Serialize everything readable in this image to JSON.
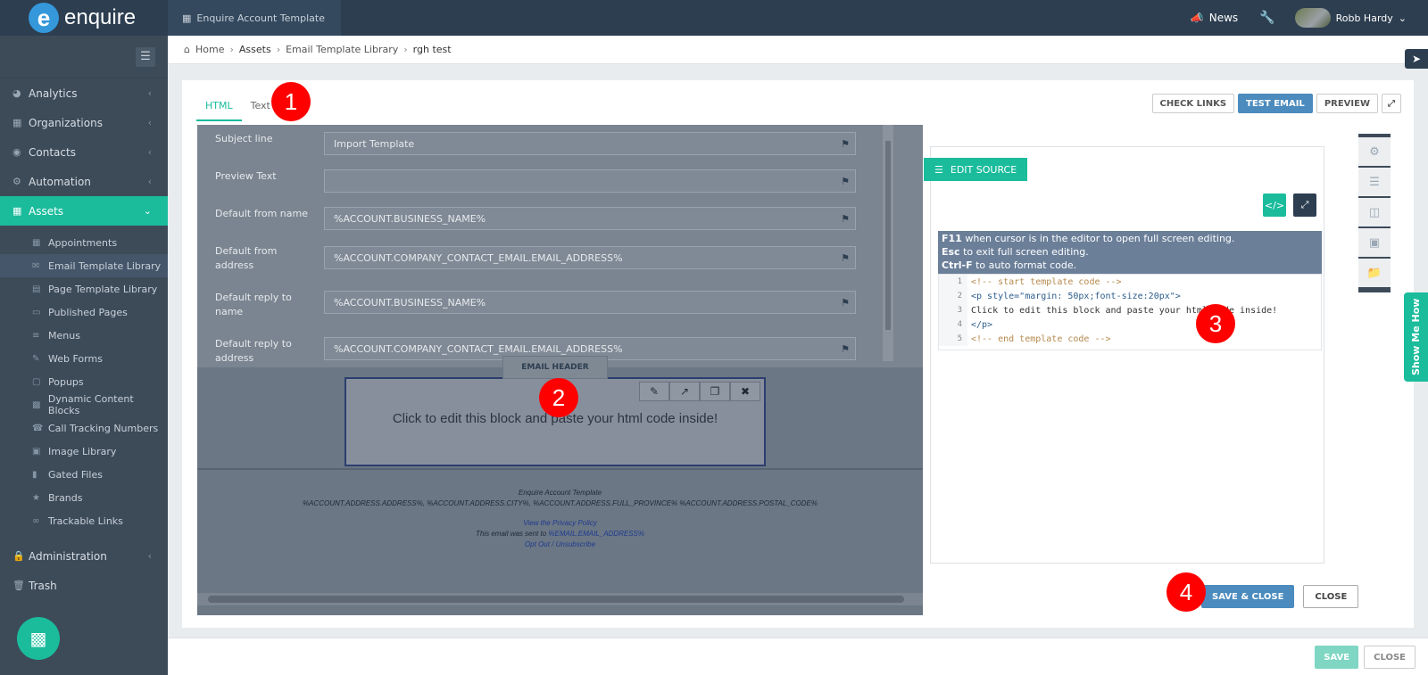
{
  "app": {
    "logo_letter": "e",
    "logo_text": "enquire",
    "account_tab": "Enquire Account Template"
  },
  "topbar": {
    "news": "News",
    "user_name": "Robb Hardy"
  },
  "sidebar": {
    "items": [
      {
        "label": "Analytics"
      },
      {
        "label": "Organizations"
      },
      {
        "label": "Contacts"
      },
      {
        "label": "Automation"
      },
      {
        "label": "Assets"
      }
    ],
    "subitems": [
      {
        "label": "Appointments"
      },
      {
        "label": "Email Template Library"
      },
      {
        "label": "Page Template Library"
      },
      {
        "label": "Published Pages"
      },
      {
        "label": "Menus"
      },
      {
        "label": "Web Forms"
      },
      {
        "label": "Popups"
      },
      {
        "label": "Dynamic Content Blocks"
      },
      {
        "label": "Call Tracking Numbers"
      },
      {
        "label": "Image Library"
      },
      {
        "label": "Gated Files"
      },
      {
        "label": "Brands"
      },
      {
        "label": "Trackable Links"
      }
    ],
    "bottom_items": [
      {
        "label": "Administration"
      },
      {
        "label": "Trash"
      }
    ]
  },
  "breadcrumb": [
    "Home",
    "Assets",
    "Email Template Library",
    "rgh test"
  ],
  "tabs": [
    "HTML",
    "Text"
  ],
  "toolbar": {
    "check_links": "CHECK LINKS",
    "test_email": "TEST EMAIL",
    "preview": "PREVIEW"
  },
  "form": [
    {
      "label": "Subject line",
      "value": "Import Template"
    },
    {
      "label": "Preview Text",
      "value": ""
    },
    {
      "label": "Default from name",
      "value": "%ACCOUNT.BUSINESS_NAME%"
    },
    {
      "label": "Default from address",
      "value": "%ACCOUNT.COMPANY_CONTACT_EMAIL.EMAIL_ADDRESS%"
    },
    {
      "label": "Default reply to name",
      "value": "%ACCOUNT.BUSINESS_NAME%"
    },
    {
      "label": "Default reply to address",
      "value": "%ACCOUNT.COMPANY_CONTACT_EMAIL.EMAIL_ADDRESS%"
    }
  ],
  "email_header_label": "EMAIL HEADER",
  "block_text": "Click to edit this block and paste your html code inside!",
  "footer": {
    "company": "Enquire Account Template",
    "address": "%ACCOUNT.ADDRESS.ADDRESS%, %ACCOUNT.ADDRESS.CITY%, %ACCOUNT.ADDRESS.FULL_PROVINCE% %ACCOUNT.ADDRESS.POSTAL_CODE%",
    "privacy": "View the Privacy Policy",
    "sent_to_prefix": "This email was sent to ",
    "sent_to_value": "%EMAIL.EMAIL_ADDRESS%",
    "opt_out": "Opt Out / Unsubscribe"
  },
  "editor": {
    "edit_source": "EDIT SOURCE",
    "hints": [
      {
        "key": "F11",
        "text": " when cursor is in the editor to open full screen editing."
      },
      {
        "key": "Esc",
        "text": " to exit full screen editing."
      },
      {
        "key": "Ctrl-F",
        "text": " to auto format code."
      }
    ],
    "code_lines": [
      {
        "n": "1",
        "text": "<!-- start template code -->"
      },
      {
        "n": "2",
        "text": "<p style=\"margin: 50px;font-size:20px\">"
      },
      {
        "n": "3",
        "text": "Click to edit this block and paste your html code inside!"
      },
      {
        "n": "4",
        "text": "</p>"
      },
      {
        "n": "5",
        "text": "<!-- end template code -->"
      }
    ],
    "save_close": "SAVE & CLOSE",
    "close": "CLOSE"
  },
  "show_me_how": "Show Me How",
  "bottom": {
    "save": "SAVE",
    "close": "CLOSE"
  },
  "markers": [
    "1",
    "2",
    "3",
    "4"
  ]
}
